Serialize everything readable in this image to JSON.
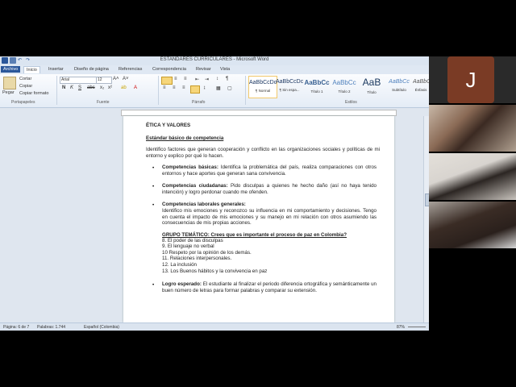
{
  "word": {
    "window_title": "ESTANDARES CURRICULARES - Microsoft Word",
    "tabs": [
      "Archivo",
      "Inicio",
      "Insertar",
      "Diseño de página",
      "Referencias",
      "Correspondencia",
      "Revisar",
      "Vista"
    ],
    "clipboard": {
      "paste": "Pegar",
      "cut": "Cortar",
      "copy": "Copiar",
      "format_painter": "Copiar formato",
      "group": "Portapapeles"
    },
    "font": {
      "name": "Arial",
      "size": "12",
      "group": "Fuente"
    },
    "paragraph_group": "Párrafo",
    "styles_group": "Estilos",
    "styles": [
      {
        "sample": "AaBbCcDc",
        "name": "¶ Normal"
      },
      {
        "sample": "AaBbCcDc",
        "name": "¶ Sin espa..."
      },
      {
        "sample": "AaBbCc",
        "name": "Título 1"
      },
      {
        "sample": "AaBbCc",
        "name": "Título 2"
      },
      {
        "sample": "AaB",
        "name": "Título"
      },
      {
        "sample": "AaBbCc",
        "name": "Subtítulo"
      },
      {
        "sample": "AaBbC",
        "name": "Énfasis"
      }
    ],
    "status": {
      "page": "Página: 6 de 7",
      "words": "Palabras: 1.744",
      "lang": "Español (Colombia)",
      "zoom": "87%"
    }
  },
  "document": {
    "heading": "ÉTICA Y VALORES",
    "standard_title": "Estándar básico de competencia",
    "standard_text": "Identifico factores que generan cooperación y conflicto en las organizaciones sociales y políticas de mi entorno y explico por qué lo hacen.",
    "b1_label": "Competencias básicas:",
    "b1_text": " Identifica la problemática del país, realiza comparaciones con otros entornos y hace aportes que generan sana convivencia.",
    "b2_label": "Competencias ciudadanas:",
    "b2_text": " Pido disculpas a quienes he hecho daño (así no haya tenido intención) y logro perdonar cuando me ofenden.",
    "b3_label": "Competencias laborales generales:",
    "b3_text": "Identifico mis emociones y reconozco su influencia en mi comportamiento y decisiones. Tengo en cuenta el impacto de mis emociones y su manejo en mi relación con otros asumiendo las consecuencias de mis propias acciones.",
    "grupo_title": "GRUPO TEMÁTICO: Crees que es importante el proceso de paz en Colombia?",
    "topics": [
      "8. El poder de las disculpas",
      "9. El lenguaje no verbal",
      "10 Respeto por la opinión de los demás.",
      "11. Relaciones interpersonales.",
      "12. La inclusión",
      "13. Los Buenos hábitos y la convivencia en paz"
    ],
    "b4_label": "Logro esperado:",
    "b4_text": " El estudiante al finalizar el periodo diferencia ortográfica y semánticamente un buen número de letras para formar palabras y comparar su extensión."
  },
  "video": {
    "initial": "J",
    "avatar_color": "#7a3b25"
  }
}
